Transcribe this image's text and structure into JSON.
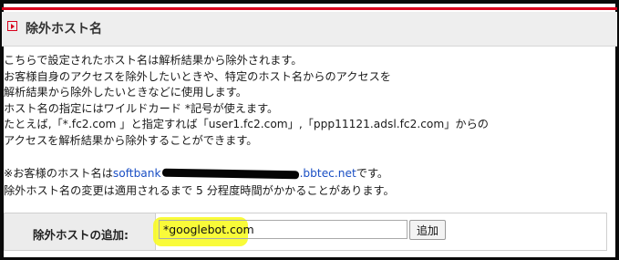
{
  "section": {
    "title": "除外ホスト名",
    "accent_color": "#d8001c"
  },
  "description": {
    "lines": [
      "こちらで設定されたホスト名は解析結果から除外されます。",
      "お客様自身のアクセスを除外したいときや、特定のホスト名からのアクセスを",
      "解析結果から除外したいときなどに使用します。",
      "ホスト名の指定にはワイルドカード *記号が使えます。",
      "たとえば,「*.fc2.com 」と指定すれば「user1.fc2.com」,「ppp11121.adsl.fc2.com」からの",
      "アクセスを解析結果から除外することができます。"
    ]
  },
  "host_info": {
    "prefix": "※お客様のホスト名は",
    "host_start": "softbank",
    "host_end": ".bbtec.net",
    "suffix": "です。"
  },
  "note": "除外ホスト名の変更は適用されるまで 5 分程度時間がかかることがあります。",
  "form": {
    "label": "除外ホストの追加:",
    "input_value": "*googlebot.com",
    "button_label": "追加"
  }
}
